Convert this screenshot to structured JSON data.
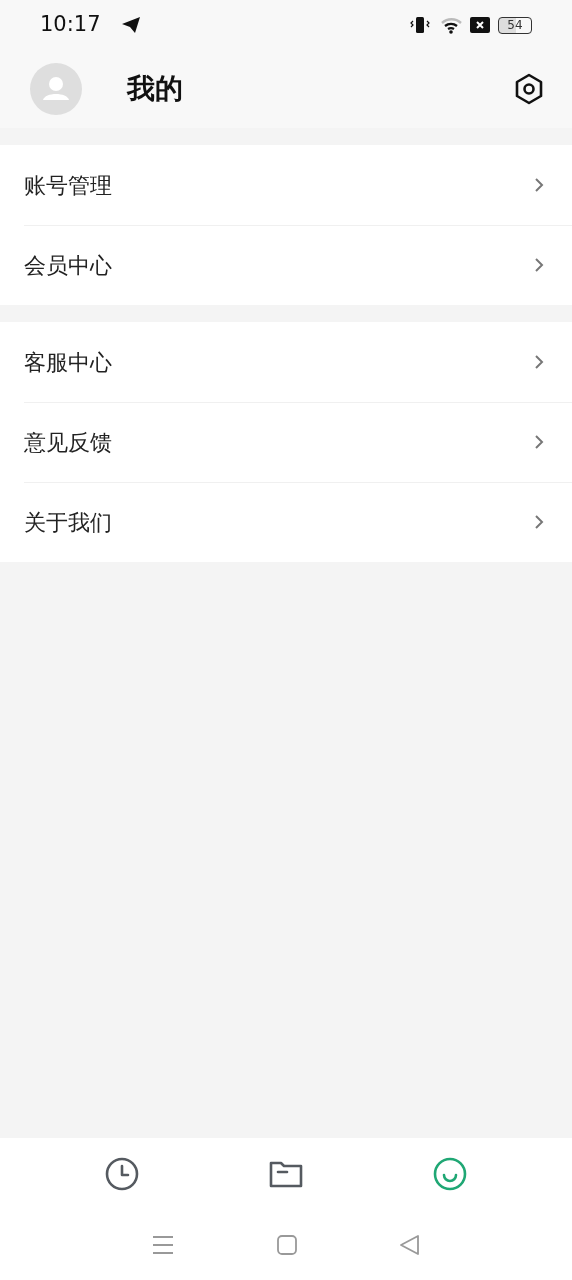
{
  "status_bar": {
    "time": "10:17",
    "battery": "54"
  },
  "header": {
    "title": "我的"
  },
  "menu_groups": [
    {
      "items": [
        {
          "label": "账号管理"
        },
        {
          "label": "会员中心"
        }
      ]
    },
    {
      "items": [
        {
          "label": "客服中心"
        },
        {
          "label": "意见反馈"
        },
        {
          "label": "关于我们"
        }
      ]
    }
  ],
  "tabs": [
    {
      "kind": "clock",
      "selected": false
    },
    {
      "kind": "folder",
      "selected": false
    },
    {
      "kind": "smile",
      "selected": true
    }
  ]
}
